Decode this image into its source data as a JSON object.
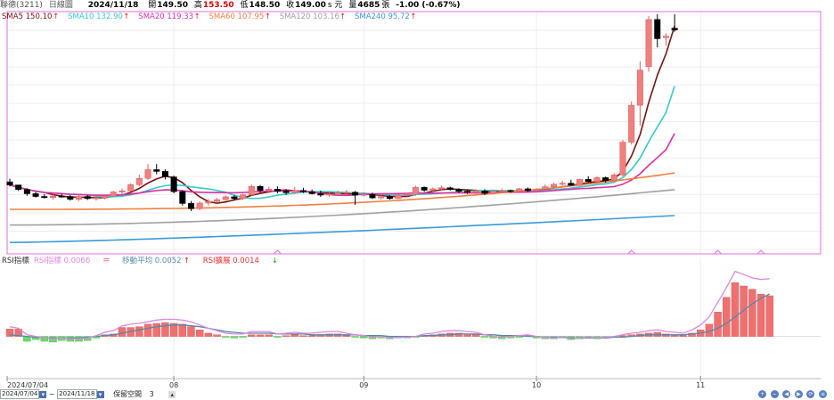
{
  "header": {
    "stock": "聯德(3211)",
    "period": "日線圖",
    "date": "2024/11/18",
    "open_label": "開",
    "open": "149.50",
    "high_label": "高",
    "high": "153.50",
    "low_label": "低",
    "low": "148.50",
    "close_label": "收",
    "close": "149.00",
    "close_suffix": "s 元",
    "volume_label": "量",
    "volume": "4685",
    "volume_unit": "張",
    "change": "-1.00 (-0.67%)"
  },
  "colors": {
    "up_candle": "#f08080",
    "down_candle": "#000000",
    "sma5": "#7a1010",
    "sma10": "#33cccc",
    "sma20": "#dd2fa6",
    "sma60": "#f08040",
    "sma120": "#a0a0a0",
    "sma240": "#3a9ad9",
    "rsi_pos": "#f07070",
    "rsi_neg": "#66dd66",
    "rsi_ma": "#5588aa",
    "rsi_line": "#dd88dd",
    "border": "#e070e0"
  },
  "chart_data": {
    "type": "line",
    "legend": [
      {
        "name": "SMA5",
        "value": "150.10",
        "arrow": "↑",
        "color": "#7a1010"
      },
      {
        "name": "SMA10",
        "value": "132.90",
        "arrow": "↑",
        "color": "#33cccc"
      },
      {
        "name": "SMA20",
        "value": "119.33",
        "arrow": "↑",
        "color": "#dd2fa6"
      },
      {
        "name": "SMA60",
        "value": "107.95",
        "arrow": "↑",
        "color": "#f08040"
      },
      {
        "name": "SMA120",
        "value": "103.16",
        "arrow": "↑",
        "color": "#a0a0a0"
      },
      {
        "name": "SMA240",
        "value": "95.72",
        "arrow": "↑",
        "color": "#3a9ad9"
      }
    ],
    "price_range": [
      86,
      153
    ],
    "candles": [
      [
        105.4,
        106.3,
        104.1,
        104.5
      ],
      [
        104.5,
        104.5,
        102.8,
        103.2
      ],
      [
        103.2,
        103.6,
        101.4,
        102.0
      ],
      [
        102.0,
        102.5,
        100.9,
        101.2
      ],
      [
        101.2,
        101.9,
        100.6,
        100.9
      ],
      [
        100.9,
        101.8,
        100.3,
        101.3
      ],
      [
        101.3,
        102.0,
        100.8,
        101.2
      ],
      [
        101.2,
        101.6,
        100.0,
        100.4
      ],
      [
        100.4,
        101.7,
        99.9,
        101.2
      ],
      [
        101.2,
        101.6,
        100.2,
        100.6
      ],
      [
        100.6,
        101.5,
        100.0,
        100.8
      ],
      [
        100.8,
        101.8,
        100.4,
        101.3
      ],
      [
        101.3,
        102.8,
        101.1,
        102.5
      ],
      [
        102.5,
        103.5,
        101.8,
        102.8
      ],
      [
        102.8,
        105.0,
        102.5,
        104.6
      ],
      [
        104.6,
        107.5,
        104.1,
        106.4
      ],
      [
        106.4,
        110.5,
        106.0,
        108.9
      ],
      [
        108.9,
        110.5,
        107.6,
        108.4
      ],
      [
        108.4,
        109.0,
        106.1,
        106.8
      ],
      [
        106.8,
        107.2,
        102.1,
        102.6
      ],
      [
        102.6,
        103.0,
        98.6,
        99.2
      ],
      [
        99.2,
        99.9,
        97.0,
        97.7
      ],
      [
        97.7,
        99.8,
        97.3,
        99.3
      ],
      [
        99.3,
        100.5,
        98.6,
        99.8
      ],
      [
        99.8,
        100.8,
        99.4,
        100.3
      ],
      [
        100.3,
        101.5,
        99.9,
        101.1
      ],
      [
        101.1,
        101.6,
        100.0,
        100.6
      ],
      [
        100.6,
        102.0,
        100.2,
        101.7
      ],
      [
        101.7,
        104.6,
        101.3,
        104.1
      ],
      [
        104.1,
        104.5,
        102.3,
        102.9
      ],
      [
        102.9,
        104.0,
        102.2,
        103.3
      ],
      [
        103.3,
        104.1,
        102.1,
        102.7
      ],
      [
        102.7,
        103.3,
        101.7,
        102.3
      ],
      [
        102.3,
        103.9,
        101.9,
        102.9
      ],
      [
        102.9,
        103.7,
        102.2,
        102.6
      ],
      [
        102.6,
        103.2,
        101.8,
        102.0
      ],
      [
        102.0,
        102.9,
        101.1,
        101.6
      ],
      [
        101.6,
        102.5,
        101.1,
        101.9
      ],
      [
        101.9,
        102.9,
        101.6,
        102.2
      ],
      [
        102.2,
        103.1,
        101.6,
        102.4
      ],
      [
        102.4,
        102.8,
        98.8,
        101.6
      ],
      [
        101.6,
        102.5,
        101.2,
        101.8
      ],
      [
        101.8,
        102.3,
        100.5,
        100.8
      ],
      [
        100.8,
        101.9,
        100.3,
        101.2
      ],
      [
        101.2,
        101.6,
        100.3,
        100.6
      ],
      [
        100.6,
        101.9,
        100.5,
        101.6
      ],
      [
        101.6,
        102.2,
        101.2,
        101.8
      ],
      [
        101.8,
        104.3,
        101.4,
        103.8
      ],
      [
        103.8,
        104.1,
        102.5,
        103.0
      ],
      [
        103.0,
        103.8,
        102.4,
        103.4
      ],
      [
        103.4,
        104.3,
        102.9,
        103.7
      ],
      [
        103.7,
        104.0,
        102.9,
        103.2
      ],
      [
        103.2,
        103.6,
        102.2,
        102.7
      ],
      [
        102.7,
        103.1,
        101.9,
        102.4
      ],
      [
        102.4,
        103.2,
        101.8,
        102.8
      ],
      [
        102.8,
        103.3,
        101.6,
        102.1
      ],
      [
        102.1,
        103.1,
        101.8,
        102.7
      ],
      [
        102.7,
        103.5,
        102.2,
        102.9
      ],
      [
        102.9,
        103.2,
        102.3,
        102.7
      ],
      [
        102.7,
        103.7,
        102.5,
        103.4
      ],
      [
        103.4,
        103.8,
        102.5,
        102.9
      ],
      [
        102.9,
        103.6,
        102.4,
        103.3
      ],
      [
        103.3,
        104.7,
        102.9,
        104.0
      ],
      [
        104.0,
        105.2,
        103.5,
        104.7
      ],
      [
        104.7,
        105.7,
        104.3,
        105.0
      ],
      [
        105.0,
        106.0,
        104.2,
        104.4
      ],
      [
        104.4,
        106.3,
        104.2,
        106.1
      ],
      [
        106.1,
        107.0,
        105.2,
        105.5
      ],
      [
        105.5,
        107.0,
        105.0,
        106.6
      ],
      [
        106.6,
        106.9,
        105.2,
        105.8
      ],
      [
        105.8,
        107.9,
        105.6,
        107.4
      ],
      [
        107.4,
        117.5,
        107.0,
        116.8
      ],
      [
        116.8,
        128.5,
        116.1,
        127.4
      ],
      [
        127.4,
        140.0,
        121.5,
        137.5
      ],
      [
        138.5,
        153.0,
        137.0,
        152.0
      ],
      [
        152.0,
        153.5,
        144.0,
        146.5
      ],
      [
        146.8,
        148.0,
        144.5,
        147.2
      ],
      [
        149.5,
        153.5,
        148.5,
        149.0
      ]
    ],
    "sma_series": [
      {
        "name": "SMA5",
        "start": 105.0,
        "end": 150.1
      },
      {
        "name": "SMA10",
        "start": 103.5,
        "end": 132.9
      },
      {
        "name": "SMA20",
        "start": 100.3,
        "end": 119.33
      },
      {
        "name": "SMA60",
        "start": 97.5,
        "end": 107.95
      },
      {
        "name": "SMA120",
        "start": 93.0,
        "end": 103.16
      },
      {
        "name": "SMA240",
        "start": 88.0,
        "end": 95.72
      }
    ],
    "rsi_legend": [
      {
        "name": "RSI指標",
        "value": "0.0066",
        "arrow": "＝",
        "color": "#dd88dd"
      },
      {
        "name": "移動平均",
        "value": "0.0052",
        "arrow": "↑",
        "color": "#5588aa"
      },
      {
        "name": "RSI擴展",
        "value": "0.0014",
        "arrow": "↓",
        "color": "#ee3030"
      }
    ],
    "rsi_title": "RSI指標",
    "rsi_range": [
      -0.003,
      0.0085
    ],
    "rsi_bars": [
      0.0009,
      0.0009,
      -0.0006,
      -0.0004,
      -0.0006,
      -0.0007,
      -0.0005,
      -0.0006,
      -0.0006,
      -0.0005,
      -0.0002,
      0.0002,
      0.0003,
      0.0011,
      0.0011,
      0.0012,
      0.0015,
      0.0016,
      0.0017,
      0.0016,
      0.0015,
      0.0012,
      0.0008,
      0.0004,
      0.0002,
      -0.0001,
      -0.0002,
      -0.0001,
      0.0002,
      0.0002,
      0.0002,
      -0.0001,
      0.0001,
      0.0002,
      0.0001,
      0.0001,
      0.0002,
      0.0003,
      0.0003,
      0.0001,
      -0.0001,
      -0.0002,
      -0.0003,
      -0.0002,
      -0.0003,
      -0.0002,
      -0.0002,
      -0.0001,
      0.0001,
      0.0002,
      0.0003,
      0.0004,
      0.0004,
      0.0003,
      0.0002,
      -0.0001,
      -0.0002,
      -0.0003,
      -0.0002,
      -0.0001,
      0.0001,
      -0.0002,
      -0.0003,
      -0.0003,
      -0.0002,
      -0.0004,
      -0.0003,
      -0.0002,
      -0.0003,
      -0.0002,
      -0.0001,
      0.0001,
      0.0002,
      0.0003,
      0.0004,
      0.0005,
      0.0003,
      0.0002,
      0.0001,
      0.0004,
      0.0008,
      0.0015,
      0.003,
      0.0048,
      0.0066,
      0.0062,
      0.0058,
      0.0052,
      0.005
    ],
    "rsi_ma": [
      0.0002,
      0.0001,
      0.0,
      -0.0001,
      -0.0002,
      -0.0002,
      -0.0002,
      -0.0002,
      -0.0002,
      -0.0001,
      0.0,
      0.0001,
      0.0002,
      0.0004,
      0.0006,
      0.0008,
      0.001,
      0.0012,
      0.0013,
      0.0014,
      0.0014,
      0.0013,
      0.0012,
      0.001,
      0.0008,
      0.0006,
      0.0005,
      0.0004,
      0.0004,
      0.0004,
      0.0004,
      0.0003,
      0.0003,
      0.0003,
      0.0003,
      0.0002,
      0.0002,
      0.0002,
      0.0002,
      0.0002,
      0.0002,
      0.0001,
      0.0001,
      0.0001,
      0.0,
      0.0,
      0.0,
      0.0,
      0.0001,
      0.0001,
      0.0002,
      0.0002,
      0.0003,
      0.0003,
      0.0003,
      0.0002,
      0.0002,
      0.0001,
      0.0001,
      0.0001,
      0.0,
      0.0,
      -0.0001,
      -0.0001,
      -0.0001,
      -0.0002,
      -0.0002,
      -0.0002,
      -0.0002,
      -0.0002,
      -0.0001,
      -0.0001,
      0.0,
      0.0001,
      0.0002,
      0.0002,
      0.0002,
      0.0002,
      0.0002,
      0.0003,
      0.0004,
      0.0006,
      0.001,
      0.0016,
      0.0024,
      0.0032,
      0.004,
      0.0047,
      0.0052
    ],
    "rsi_line": [
      0.0012,
      0.001,
      0.0002,
      0.0,
      -0.0002,
      -0.0003,
      -0.0002,
      -0.0003,
      -0.0003,
      -0.0002,
      0.0001,
      0.0005,
      0.0007,
      0.0013,
      0.0015,
      0.0016,
      0.0018,
      0.002,
      0.0021,
      0.0021,
      0.002,
      0.0018,
      0.0014,
      0.001,
      0.0007,
      0.0004,
      0.0003,
      0.0003,
      0.0006,
      0.0006,
      0.0006,
      0.0003,
      0.0004,
      0.0005,
      0.0004,
      0.0004,
      0.0005,
      0.0006,
      0.0006,
      0.0004,
      0.0002,
      0.0001,
      -0.0001,
      0.0,
      -0.0002,
      -0.0001,
      -0.0001,
      0.0,
      0.0003,
      0.0004,
      0.0006,
      0.0007,
      0.0007,
      0.0006,
      0.0005,
      0.0002,
      0.0,
      -0.0001,
      0.0,
      0.0001,
      0.0002,
      0.0,
      -0.0001,
      -0.0002,
      -0.0001,
      -0.0003,
      -0.0002,
      -0.0001,
      -0.0002,
      -0.0001,
      0.0,
      0.0002,
      0.0004,
      0.0005,
      0.0007,
      0.0008,
      0.0006,
      0.0005,
      0.0004,
      0.0008,
      0.0014,
      0.0024,
      0.0042,
      0.006,
      0.008,
      0.0076,
      0.0072,
      0.007,
      0.0071
    ],
    "x_ticks": [
      {
        "label": "2024/07/04",
        "index": 0
      },
      {
        "label": "08",
        "index": 19
      },
      {
        "label": "09",
        "index": 41
      },
      {
        "label": "10",
        "index": 61
      },
      {
        "label": "11",
        "index": 80
      }
    ]
  },
  "bottombar": {
    "start_date": "2024/07/04",
    "sep": "~",
    "end_date": "2024/11/18",
    "keep_label": "保留空間",
    "keep_value": "3"
  }
}
